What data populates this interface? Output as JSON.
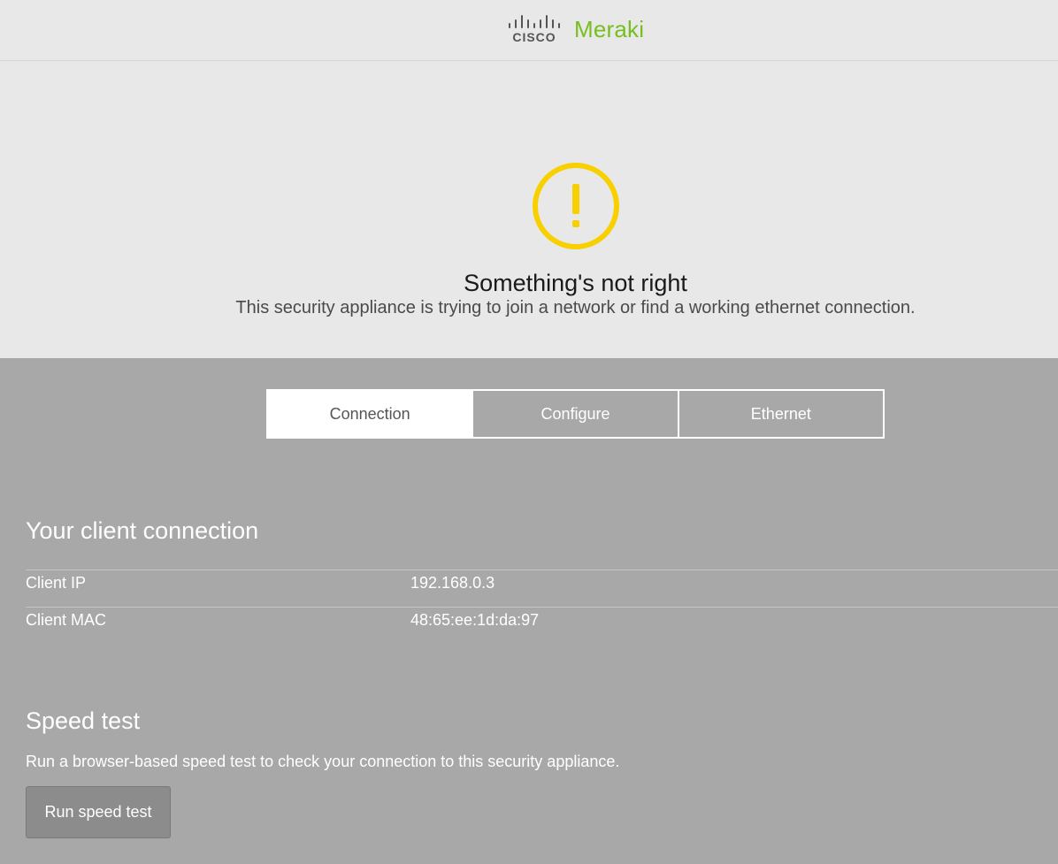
{
  "header": {
    "logo_icon": "cisco-logo-icon",
    "cisco_text": "CISCO",
    "brand": "Meraki",
    "brand_color": "#78be20"
  },
  "hero": {
    "icon": "warning-icon",
    "icon_color": "#f8d000",
    "title": "Something's not right",
    "subtitle": "This security appliance is trying to join a network or find a working ethernet connection."
  },
  "tabs": [
    {
      "label": "Connection",
      "active": true
    },
    {
      "label": "Configure",
      "active": false
    },
    {
      "label": "Ethernet",
      "active": false
    }
  ],
  "client_connection": {
    "title": "Your client connection",
    "rows": [
      {
        "label": "Client IP",
        "value": "192.168.0.3"
      },
      {
        "label": "Client MAC",
        "value": "48:65:ee:1d:da:97"
      }
    ]
  },
  "speed_test": {
    "title": "Speed test",
    "description": "Run a browser-based speed test to check your connection to this security appliance.",
    "button_label": "Run speed test"
  }
}
